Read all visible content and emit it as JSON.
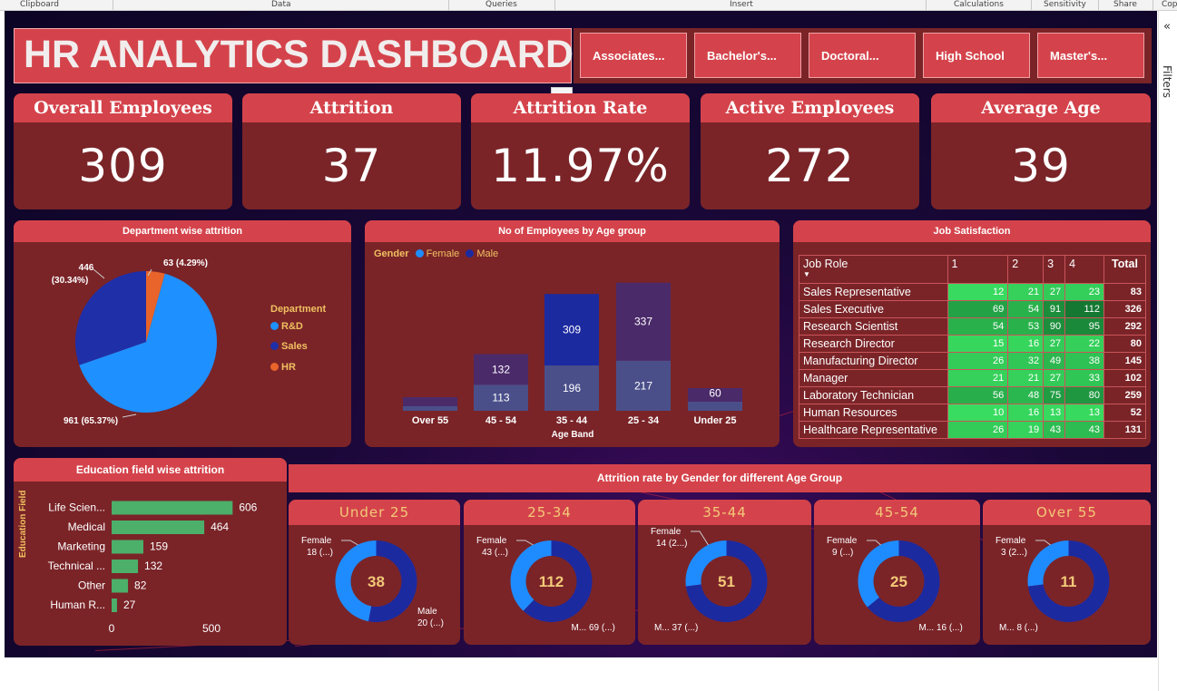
{
  "ribbon": {
    "groups": [
      "Clipboard",
      "Data",
      "Queries",
      "Insert",
      "Calculations",
      "Sensitivity",
      "Share",
      "Cop"
    ]
  },
  "filters_pane": {
    "label": "Filters",
    "collapse_icon": "double-chevron-left-icon",
    "filter_icon": "funnel-icon"
  },
  "title": "HR ANALYTICS DASHBOARD",
  "slicers": [
    "Associates...",
    "Bachelor's...",
    "Doctoral...",
    "High School",
    "Master's..."
  ],
  "more_options": "...",
  "kpis": [
    {
      "label": "Overall Employees",
      "value": "309"
    },
    {
      "label": "Attrition",
      "value": "37"
    },
    {
      "label": "Attrition Rate",
      "value": "11.97%"
    },
    {
      "label": "Active Employees",
      "value": "272"
    },
    {
      "label": "Average Age",
      "value": "39"
    }
  ],
  "colors": {
    "card_bg": "#7a2428",
    "header": "#d4434b",
    "rd": "#1e90ff",
    "sales": "#1f2fa8",
    "hr": "#e8642a",
    "female": "#1e8cff",
    "male": "#1c2aa0",
    "bar_green": "#4caf6a",
    "legend_text": "#f0c060"
  },
  "chart_data": [
    {
      "type": "pie",
      "title": "Department wise attrition",
      "legend_title": "Department",
      "categories": [
        "R&D",
        "Sales",
        "HR"
      ],
      "values": [
        961,
        446,
        63
      ],
      "labels": [
        "961 (65.37%)",
        "446 (30.34%)",
        "63 (4.29%)"
      ]
    },
    {
      "type": "bar",
      "title": "No of Employees by Age group",
      "legend_title": "Gender",
      "xlabel": "Age Band",
      "categories": [
        "Over 55",
        "45 - 54",
        "35 - 44",
        "25 - 34",
        "Under 25"
      ],
      "series": [
        {
          "name": "Female",
          "values": [
            null,
            113,
            196,
            217,
            null
          ]
        },
        {
          "name": "Male",
          "values": [
            null,
            132,
            309,
            337,
            60
          ]
        }
      ]
    },
    {
      "type": "table",
      "title": "Job Satisfaction",
      "columns": [
        "Job Role",
        "1",
        "2",
        "3",
        "4",
        "Total"
      ],
      "rows": [
        [
          "Sales Representative",
          "12",
          "21",
          "27",
          "23",
          "83"
        ],
        [
          "Sales Executive",
          "69",
          "54",
          "91",
          "112",
          "326"
        ],
        [
          "Research Scientist",
          "54",
          "53",
          "90",
          "95",
          "292"
        ],
        [
          "Research Director",
          "15",
          "16",
          "27",
          "22",
          "80"
        ],
        [
          "Manufacturing Director",
          "26",
          "32",
          "49",
          "38",
          "145"
        ],
        [
          "Manager",
          "21",
          "21",
          "27",
          "33",
          "102"
        ],
        [
          "Laboratory Technician",
          "56",
          "48",
          "75",
          "80",
          "259"
        ],
        [
          "Human Resources",
          "10",
          "16",
          "13",
          "13",
          "52"
        ],
        [
          "Healthcare Representative",
          "26",
          "19",
          "43",
          "43",
          "131"
        ]
      ]
    },
    {
      "type": "bar",
      "title": "Education field wise attrition",
      "ylabel": "Education Field",
      "categories": [
        "Life Scien...",
        "Medical",
        "Marketing",
        "Technical ...",
        "Other",
        "Human R..."
      ],
      "values": [
        606,
        464,
        159,
        132,
        82,
        27
      ],
      "xticks": [
        "0",
        "500"
      ],
      "xlim": [
        0,
        650
      ]
    },
    {
      "type": "pie",
      "title": "Attrition rate by Gender for different Age Group",
      "groups": [
        {
          "name": "Under 25",
          "center": "38",
          "female_label": "Female",
          "female_value": "18 (...)",
          "male_label": "Male",
          "male_value": "20 (...)",
          "female_share": 0.47
        },
        {
          "name": "25-34",
          "center": "112",
          "female_label": "Female",
          "female_value": "43 (...)",
          "male_label": "M...",
          "male_value": "69 (...)",
          "female_share": 0.38
        },
        {
          "name": "35-44",
          "center": "51",
          "female_label": "Female",
          "female_value": "14 (2...)",
          "male_label": "M...",
          "male_value": "37 (...)",
          "female_share": 0.27
        },
        {
          "name": "45-54",
          "center": "25",
          "female_label": "Female",
          "female_value": "9 (...)",
          "male_label": "M...",
          "male_value": "16 (...)",
          "female_share": 0.36
        },
        {
          "name": "Over 55",
          "center": "11",
          "female_label": "Female",
          "female_value": "3 (2...)",
          "male_label": "M...",
          "male_value": "8 (...)",
          "female_share": 0.27
        }
      ]
    }
  ]
}
